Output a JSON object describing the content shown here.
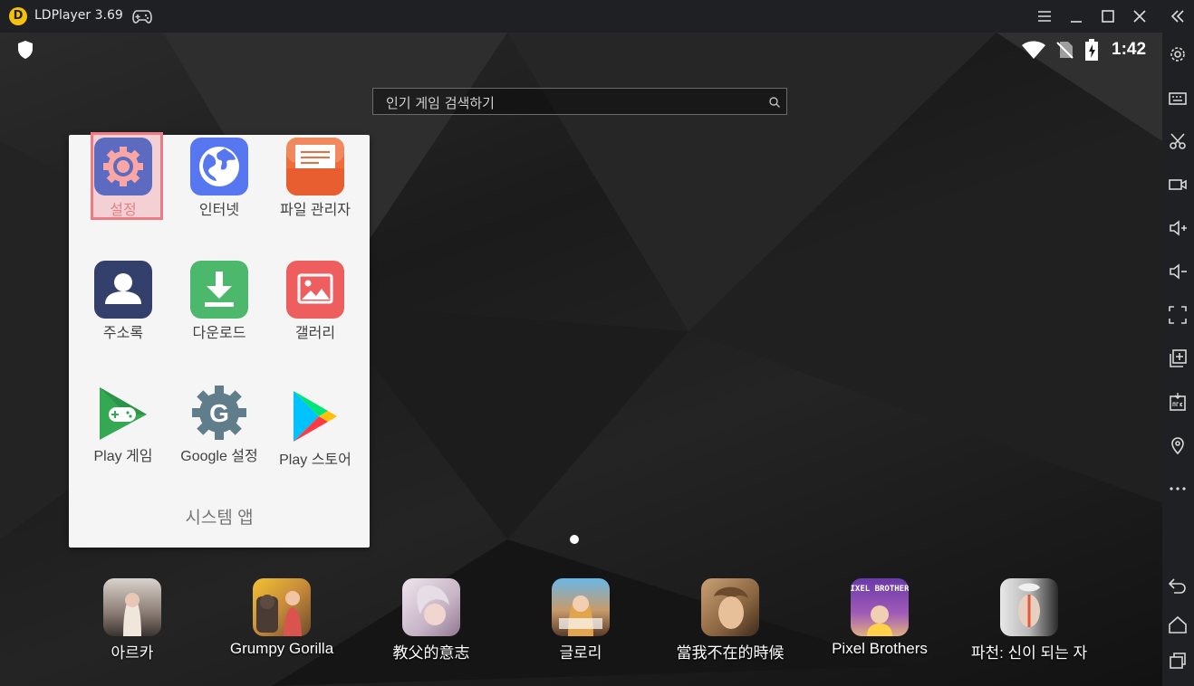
{
  "window": {
    "title": "LDPlayer 3.69",
    "logo_letter": "D",
    "icons": [
      "gamepad-icon",
      "menu-icon",
      "minimize-icon",
      "maximize-icon",
      "close-icon",
      "collapse-icon"
    ]
  },
  "toolbar": {
    "icons": [
      "gear-icon",
      "keyboard-icon",
      "scissors-icon",
      "video-record-icon",
      "volume-up-icon",
      "volume-down-icon",
      "fullscreen-icon",
      "add-instance-icon",
      "apk-install-icon",
      "location-icon",
      "more-icon",
      "back-icon",
      "home-icon",
      "recent-apps-icon"
    ]
  },
  "status_bar": {
    "time": "1:42",
    "icons": [
      "shield-icon",
      "wifi-icon",
      "no-sim-icon",
      "battery-charging-icon"
    ]
  },
  "search": {
    "placeholder": "인기 게임 검색하기"
  },
  "folder": {
    "name": "시스템 앱",
    "apps": [
      {
        "label": "설정",
        "icon": "gear-icon",
        "color": "#5c6bc0",
        "highlighted": true
      },
      {
        "label": "인터넷",
        "icon": "globe-icon",
        "color": "#5677f0"
      },
      {
        "label": "파일 관리자",
        "icon": "folder-icon",
        "color": "#ef6c3c"
      },
      {
        "label": "주소록",
        "icon": "person-icon",
        "color": "#33406b"
      },
      {
        "label": "다운로드",
        "icon": "download-icon",
        "color": "#4cb86b"
      },
      {
        "label": "갤러리",
        "icon": "image-icon",
        "color": "#ef5e5e"
      },
      {
        "label": "Play 게임",
        "icon": "play-games-icon",
        "color": "#34a853"
      },
      {
        "label": "Google 설정",
        "icon": "google-gear-icon",
        "color": "#607d8b"
      },
      {
        "label": "Play 스토어",
        "icon": "play-store-icon",
        "color": "#00c2ff"
      }
    ]
  },
  "dock": {
    "apps": [
      {
        "label": "아르카",
        "icon": "arka-icon"
      },
      {
        "label": "Grumpy Gorilla",
        "icon": "grumpy-gorilla-icon"
      },
      {
        "label": "教父的意志",
        "icon": "godfather-will-icon"
      },
      {
        "label": "글로리",
        "icon": "glory-icon"
      },
      {
        "label": "當我不在的時候",
        "icon": "when-im-away-icon"
      },
      {
        "label": "Pixel Brothers",
        "icon": "pixel-brothers-icon",
        "logo_text": "PIXEL BROTHERS"
      },
      {
        "label": "파천: 신이 되는 자",
        "icon": "pacheon-icon"
      }
    ]
  },
  "page_indicator": {
    "current": 1,
    "total": 1
  }
}
